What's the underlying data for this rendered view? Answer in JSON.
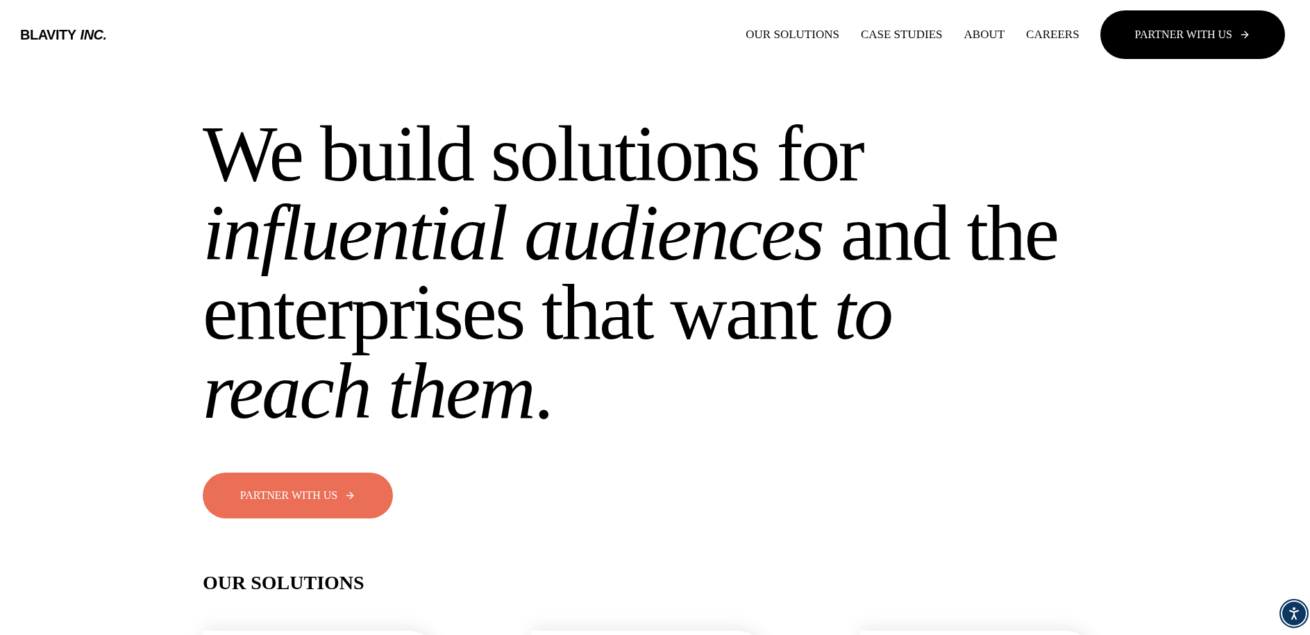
{
  "header": {
    "logo": "BLAVITY",
    "logo_suffix": "INC.",
    "nav": [
      "OUR SOLUTIONS",
      "CASE STUDIES",
      "ABOUT",
      "CAREERS"
    ],
    "cta": "PARTNER WITH US"
  },
  "hero": {
    "headline_lines": [
      "We build solutions for",
      "*influential audiences* and the",
      "enterprises that want *to*",
      "*reach them*."
    ],
    "cta": "PARTNER WITH US"
  },
  "solutions": {
    "heading": "OUR SOLUTIONS"
  }
}
